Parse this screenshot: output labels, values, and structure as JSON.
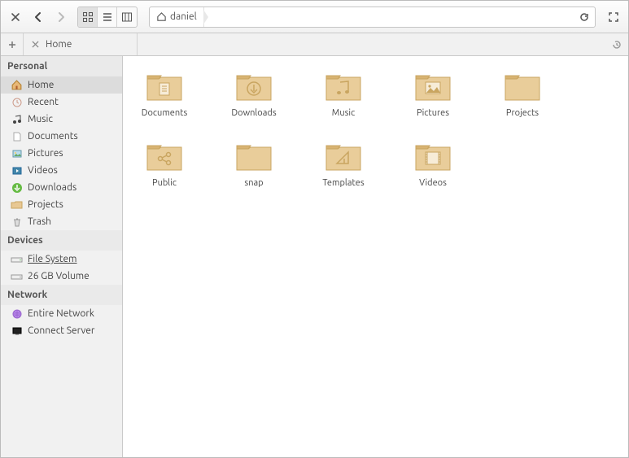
{
  "path": {
    "crumb": "daniel"
  },
  "sidebar": {
    "sections": {
      "personal": {
        "title": "Personal",
        "items": [
          "Home",
          "Recent",
          "Music",
          "Documents",
          "Pictures",
          "Videos",
          "Downloads",
          "Projects",
          "Trash"
        ]
      },
      "devices": {
        "title": "Devices",
        "items": [
          "File System",
          "26 GB Volume"
        ]
      },
      "network": {
        "title": "Network",
        "items": [
          "Entire Network",
          "Connect Server"
        ]
      }
    }
  },
  "tab": {
    "title": "Home"
  },
  "grid": [
    {
      "label": "Documents",
      "icon": "doc"
    },
    {
      "label": "Downloads",
      "icon": "down"
    },
    {
      "label": "Music",
      "icon": "music"
    },
    {
      "label": "Pictures",
      "icon": "pic"
    },
    {
      "label": "Projects",
      "icon": "plain"
    },
    {
      "label": "Public",
      "icon": "share"
    },
    {
      "label": "snap",
      "icon": "plain"
    },
    {
      "label": "Templates",
      "icon": "tmpl"
    },
    {
      "label": "Videos",
      "icon": "video"
    }
  ]
}
